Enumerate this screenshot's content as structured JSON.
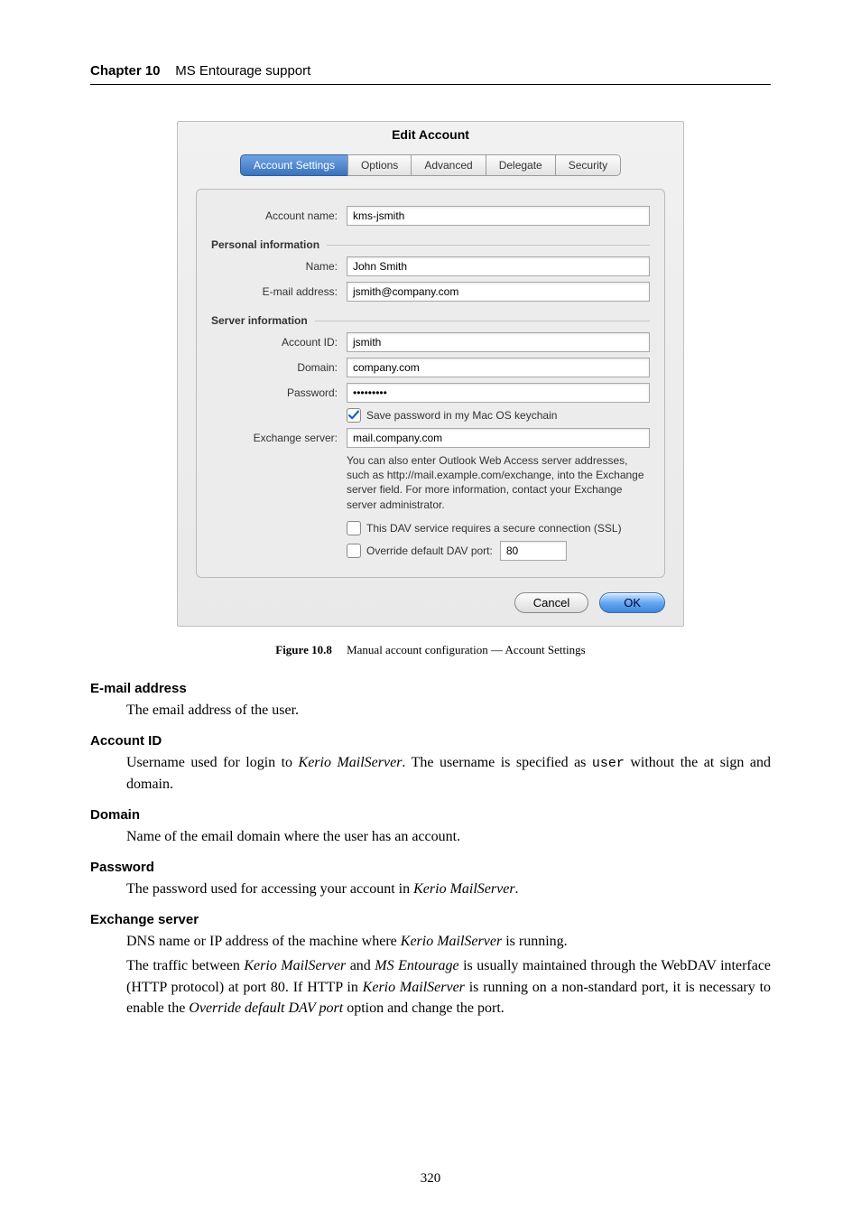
{
  "chapter": {
    "prefix": "Chapter 10",
    "title": "MS Entourage support"
  },
  "dialog": {
    "title": "Edit Account",
    "tabs": [
      "Account Settings",
      "Options",
      "Advanced",
      "Delegate",
      "Security"
    ],
    "active_tab": 0,
    "account_name_label": "Account name:",
    "account_name_value": "kms-jsmith",
    "section_personal": "Personal information",
    "name_label": "Name:",
    "name_value": "John Smith",
    "email_label": "E-mail address:",
    "email_value": "jsmith@company.com",
    "section_server": "Server information",
    "account_id_label": "Account ID:",
    "account_id_value": "jsmith",
    "domain_label": "Domain:",
    "domain_value": "company.com",
    "password_label": "Password:",
    "password_value": "•••••••••",
    "save_keychain_label": "Save password in my Mac OS keychain",
    "save_keychain_checked": true,
    "exchange_label": "Exchange server:",
    "exchange_value": "mail.company.com",
    "note_text": "You can also enter Outlook Web Access server addresses, such as http://mail.example.com/exchange, into the Exchange server field. For more information, contact your Exchange server administrator.",
    "ssl_label": "This DAV service requires a secure connection (SSL)",
    "ssl_checked": false,
    "override_port_label": "Override default DAV port:",
    "override_port_checked": false,
    "override_port_value": "80",
    "cancel_label": "Cancel",
    "ok_label": "OK"
  },
  "caption": {
    "prefix": "Figure 10.8",
    "text": "Manual account configuration — Account Settings"
  },
  "defs": {
    "email_term": "E-mail address",
    "email_body_plain": "The email address of the user.",
    "accountid_term": "Account ID",
    "accountid_body_pre": "Username used for login to ",
    "accountid_body_em": "Kerio MailServer",
    "accountid_body_mid": ". The username is specified as ",
    "accountid_body_code": "user",
    "accountid_body_post": " without the at sign and domain.",
    "domain_term": "Domain",
    "domain_body_plain": "Name of the email domain where the user has an account.",
    "password_term": "Password",
    "password_body_pre": "The password used for accessing your account in ",
    "password_body_em": "Kerio MailServer",
    "password_body_post": ".",
    "exchange_term": "Exchange server",
    "exchange_p1_pre": "DNS name or IP address of the machine where ",
    "exchange_p1_em": "Kerio MailServer",
    "exchange_p1_post": " is running.",
    "exchange_p2_a": "The traffic between ",
    "exchange_p2_em1": "Kerio MailServer",
    "exchange_p2_b": " and ",
    "exchange_p2_em2": "MS Entourage",
    "exchange_p2_c": " is usually maintained through the WebDAV interface (HTTP protocol) at port 80. If HTTP in ",
    "exchange_p2_em3": "Kerio MailServer",
    "exchange_p2_d": " is running on a non-standard port, it is necessary to enable the ",
    "exchange_p2_em4": "Override default DAV port",
    "exchange_p2_e": " option and change the port."
  },
  "page_number": "320"
}
